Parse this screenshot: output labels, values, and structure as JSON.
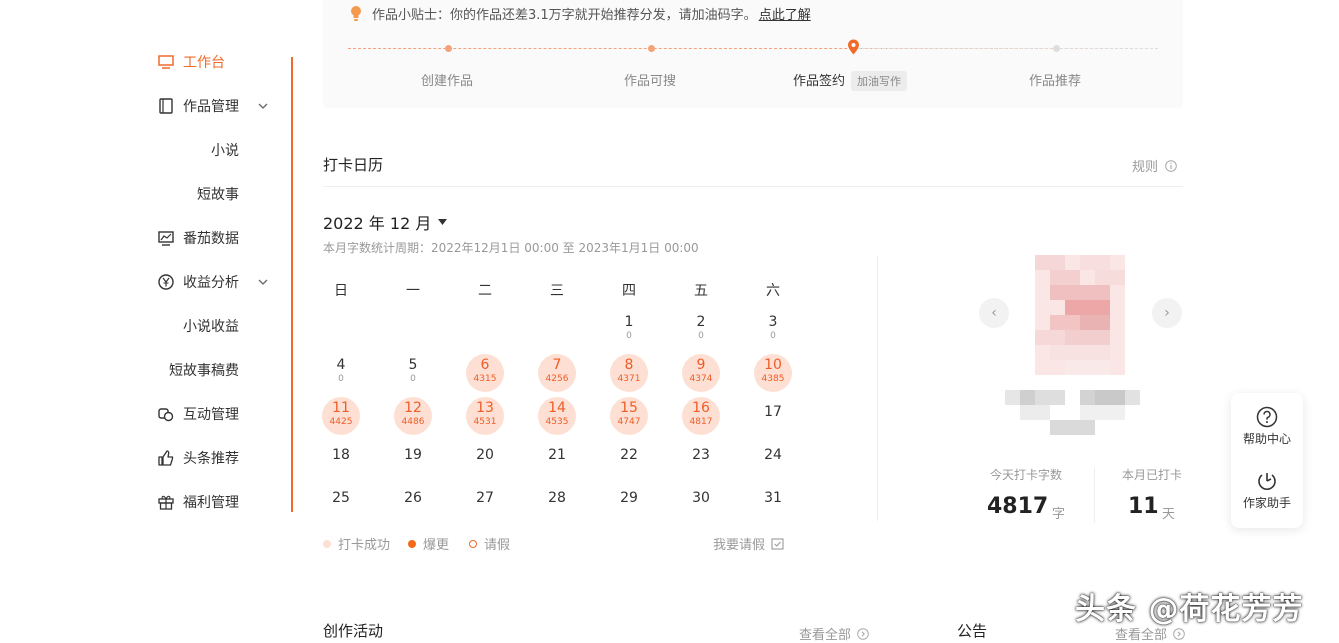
{
  "sidebar": {
    "items": [
      {
        "label": "工作台",
        "icon": "monitor-icon"
      },
      {
        "label": "作品管理",
        "icon": "book-icon"
      },
      {
        "label": "小说"
      },
      {
        "label": "短故事"
      },
      {
        "label": "番茄数据",
        "icon": "chart-icon"
      },
      {
        "label": "收益分析",
        "icon": "yen-icon"
      },
      {
        "label": "小说收益"
      },
      {
        "label": "短故事稿费"
      },
      {
        "label": "互动管理",
        "icon": "interact-icon"
      },
      {
        "label": "头条推荐",
        "icon": "thumb-up-icon"
      },
      {
        "label": "福利管理",
        "icon": "gift-icon"
      }
    ]
  },
  "tip": {
    "text": "作品小贴士：你的作品还差3.1万字就开始推荐分发，请加油码字。",
    "link": "点此了解"
  },
  "steps": {
    "s1": "创建作品",
    "s2": "作品可搜",
    "s3": "作品签约",
    "s3_badge": "加油写作",
    "s4": "作品推荐"
  },
  "calendar": {
    "title": "打卡日历",
    "rules": "规则",
    "month": "2022 年 12 月",
    "period": "本月字数统计周期：2022年12月1日 00:00 至 2023年1月1日 00:00",
    "weekdays": [
      "日",
      "一",
      "二",
      "三",
      "四",
      "五",
      "六"
    ],
    "days": [
      {
        "n": "1",
        "c": "0"
      },
      {
        "n": "2",
        "c": "0"
      },
      {
        "n": "3",
        "c": "0"
      },
      {
        "n": "4",
        "c": "0"
      },
      {
        "n": "5",
        "c": "0"
      },
      {
        "n": "6",
        "c": "4315"
      },
      {
        "n": "7",
        "c": "4256"
      },
      {
        "n": "8",
        "c": "4371"
      },
      {
        "n": "9",
        "c": "4374"
      },
      {
        "n": "10",
        "c": "4385"
      },
      {
        "n": "11",
        "c": "4425"
      },
      {
        "n": "12",
        "c": "4486"
      },
      {
        "n": "13",
        "c": "4531"
      },
      {
        "n": "14",
        "c": "4535"
      },
      {
        "n": "15",
        "c": "4747"
      },
      {
        "n": "16",
        "c": "4817"
      },
      {
        "n": "17",
        "c": ""
      },
      {
        "n": "18",
        "c": ""
      },
      {
        "n": "19",
        "c": ""
      },
      {
        "n": "20",
        "c": ""
      },
      {
        "n": "21",
        "c": ""
      },
      {
        "n": "22",
        "c": ""
      },
      {
        "n": "23",
        "c": ""
      },
      {
        "n": "24",
        "c": ""
      },
      {
        "n": "25",
        "c": ""
      },
      {
        "n": "26",
        "c": ""
      },
      {
        "n": "27",
        "c": ""
      },
      {
        "n": "28",
        "c": ""
      },
      {
        "n": "29",
        "c": ""
      },
      {
        "n": "30",
        "c": ""
      },
      {
        "n": "31",
        "c": ""
      }
    ],
    "legend_success": "打卡成功",
    "legend_burst": "爆更",
    "legend_leave": "请假",
    "request_leave": "我要请假",
    "colors": {
      "hit_bg": "#fde0d3",
      "hit_text": "#ee5d28",
      "burst": "#f06a1a",
      "accent": "#f06a2a"
    }
  },
  "stats": {
    "today_label": "今天打卡字数",
    "today_value": "4817",
    "today_unit": "字",
    "month_label": "本月已打卡",
    "month_value": "11",
    "month_unit": "天"
  },
  "float_panel": {
    "help": "帮助中心",
    "assistant": "作家助手"
  },
  "bottom": {
    "activity_title": "创作活动",
    "activity_more": "查看全部",
    "notice_title": "公告",
    "notice_more": "查看全部"
  },
  "watermark": "头条 @荷花芳芳"
}
